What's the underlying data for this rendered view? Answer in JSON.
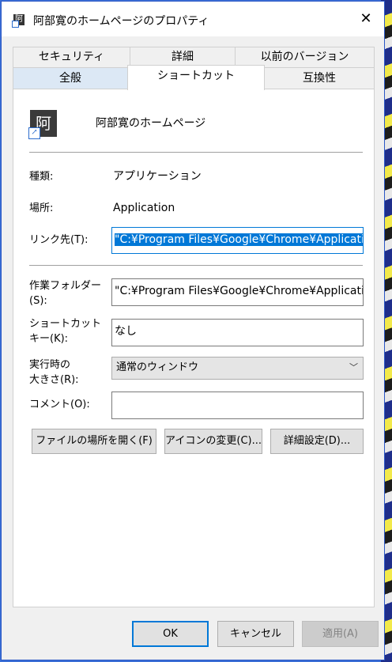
{
  "window": {
    "title": "阿部寛のホームページのプロパティ",
    "close_glyph": "✕"
  },
  "tabs_back": [
    "セキュリティ",
    "詳細",
    "以前のバージョン"
  ],
  "tabs_front": [
    "全般",
    "ショートカット",
    "互換性"
  ],
  "app": {
    "icon_char": "阿",
    "shortcut_arrow": "↗",
    "name": "阿部寛のホームページ"
  },
  "fields": {
    "type_label": "種類:",
    "type_value": "アプリケーション",
    "location_label": "場所:",
    "location_value": "Application",
    "target_label": "リンク先(T):",
    "target_value": "\"C:¥Program Files¥Google¥Chrome¥Application",
    "startin_label_1": "作業フォルダー",
    "startin_label_2": "(S):",
    "startin_value": "\"C:¥Program Files¥Google¥Chrome¥Application",
    "hotkey_label_1": "ショートカット",
    "hotkey_label_2": "キー(K):",
    "hotkey_value": "なし",
    "run_label_1": "実行時の",
    "run_label_2": "大きさ(R):",
    "run_value": "通常のウィンドウ",
    "comment_label": "コメント(O):",
    "comment_value": ""
  },
  "buttons": {
    "open_location": "ファイルの場所を開く(F)",
    "change_icon": "アイコンの変更(C)...",
    "advanced": "詳細設定(D)...",
    "ok": "OK",
    "cancel": "キャンセル",
    "apply": "適用(A)"
  },
  "icons": {
    "chevron": "﹀"
  }
}
